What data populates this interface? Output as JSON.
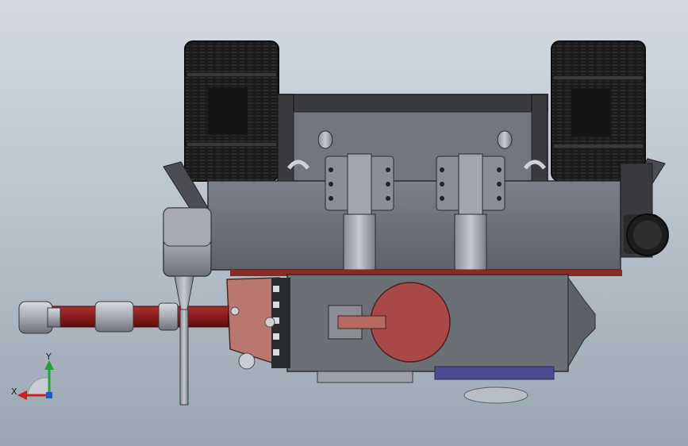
{
  "viewport": {
    "background_top": "#d4d9df",
    "background_bottom": "#9aa6b3"
  },
  "triad": {
    "x_label": "X",
    "y_label": "Y",
    "x_color": "#d21d1d",
    "y_color": "#1fa33a"
  },
  "colors": {
    "tire": "#1b1b1b",
    "chassis": "#6f7178",
    "frame": "#3a3b3f",
    "shaft": "#8a1b1b",
    "copper_plate": "#b9776f",
    "disc": "#a84848",
    "bearing": "#a9abb2",
    "base_blue": "#4b4c8f"
  },
  "icons": {
    "triad": "coordinate-axes-icon"
  }
}
